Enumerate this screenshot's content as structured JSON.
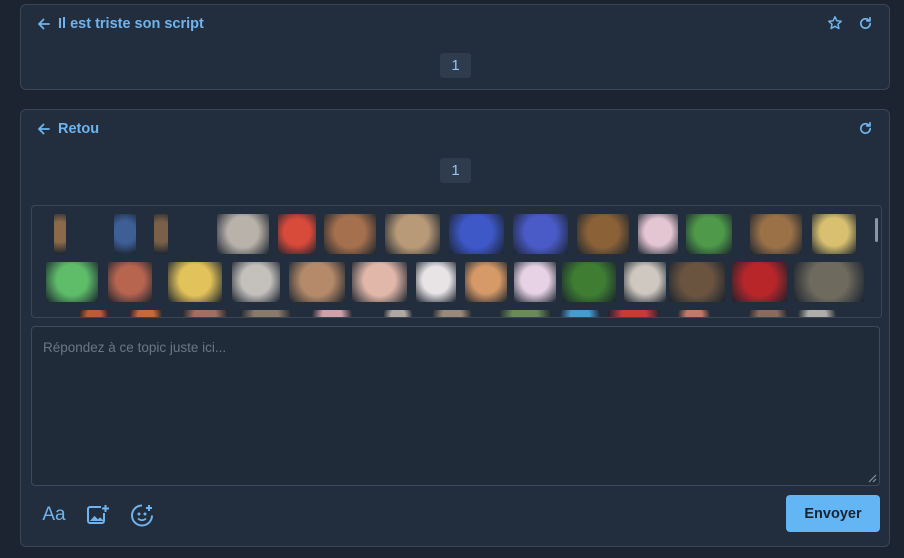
{
  "topic_panel": {
    "title": "Il est triste son script",
    "back_icon": "arrow-left-icon",
    "favorite_icon": "star-icon",
    "refresh_icon": "refresh-icon",
    "page": "1"
  },
  "reply_panel": {
    "title": "Retou",
    "back_icon": "arrow-left-icon",
    "refresh_icon": "refresh-icon",
    "page": "1",
    "sticker_count": 40,
    "textarea_placeholder": "Répondez à ce topic juste ici...",
    "toolbar": {
      "format_label": "Aa",
      "format_icon": "text-format-icon",
      "image_icon": "add-image-icon",
      "sticker_icon": "add-sticker-icon"
    },
    "send_label": "Envoyer"
  },
  "colors": {
    "page_bg": "#1b2430",
    "panel_bg": "#222e3d",
    "accent": "#6fb4ee",
    "send_button": "#63b6f3"
  }
}
